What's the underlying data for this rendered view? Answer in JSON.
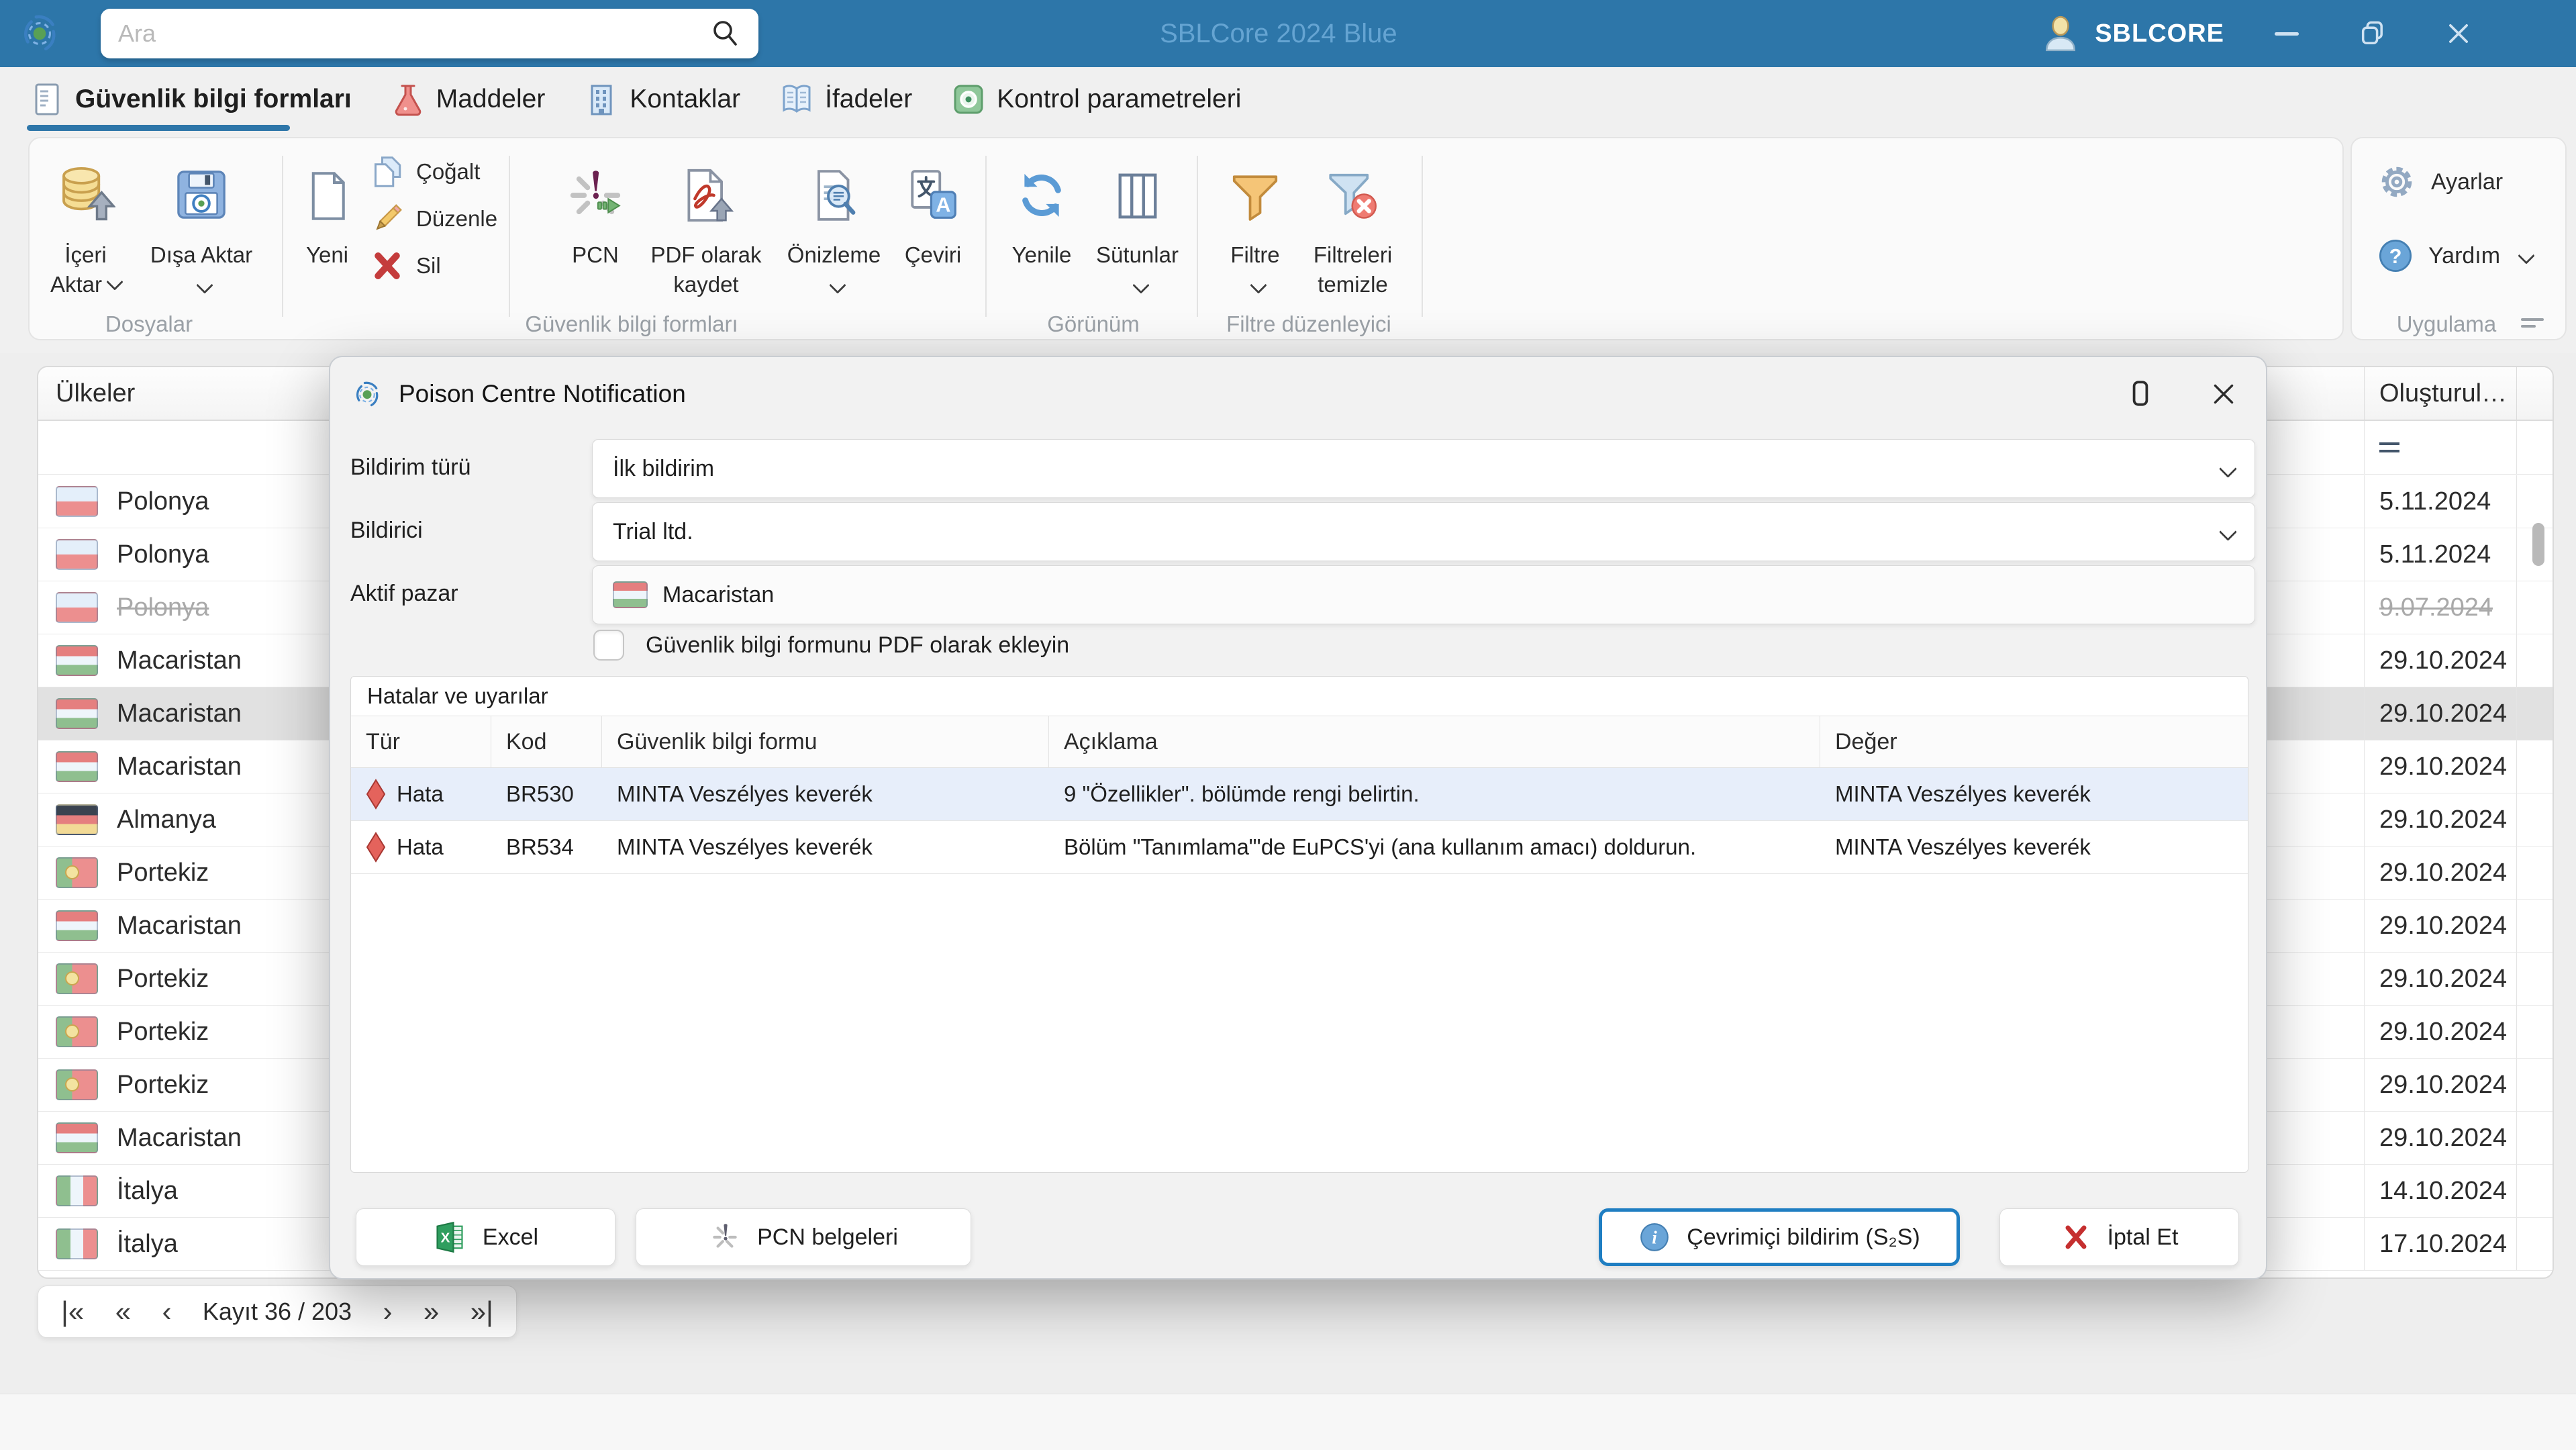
{
  "colors": {
    "titlebar_bg": "#2d76a9",
    "accent": "#2e76a9",
    "primary_button_border": "#1f7ec2",
    "error_red": "#e4635c",
    "selected_row": "#e1e1e1",
    "error_row_selected": "#e7eefa"
  },
  "titlebar": {
    "search_placeholder": "Ara",
    "app_title": "SBLCore 2024 Blue",
    "account_label": "SBLCORE"
  },
  "tabs": [
    {
      "label": "Güvenlik bilgi formları",
      "active": true
    },
    {
      "label": "Maddeler",
      "active": false
    },
    {
      "label": "Kontaklar",
      "active": false
    },
    {
      "label": "İfadeler",
      "active": false
    },
    {
      "label": "Kontrol parametreleri",
      "active": false
    }
  ],
  "ribbon": {
    "groups": {
      "dosyalar": "Dosyalar",
      "guvenlik": "Güvenlik bilgi formları",
      "gorunum": "Görünüm",
      "filtre_duzenleyici": "Filtre düzenleyici",
      "uygulama": "Uygulama"
    },
    "buttons": {
      "iceri_l1": "İçeri",
      "iceri_l2": "Aktar",
      "disa": "Dışa Aktar",
      "yeni": "Yeni",
      "cogalt": "Çoğalt",
      "duzenle": "Düzenle",
      "sil": "Sil",
      "pcn": "PCN",
      "pdf_l1": "PDF olarak",
      "pdf_l2": "kaydet",
      "onizleme": "Önizleme",
      "ceviri": "Çeviri",
      "yenile": "Yenile",
      "sutunlar": "Sütunlar",
      "filtre": "Filtre",
      "filtreleri_l1": "Filtreleri",
      "filtreleri_l2": "temizle",
      "ayarlar": "Ayarlar",
      "yardim": "Yardım"
    }
  },
  "table": {
    "header_country": "Ülkeler",
    "header_created": "Oluşturul…",
    "rows": [
      {
        "country": "Polonya",
        "flag": "pl",
        "date": "5.11.2024"
      },
      {
        "country": "Polonya",
        "flag": "pl",
        "date": "5.11.2024"
      },
      {
        "country": "Polonya",
        "flag": "pl",
        "date": "9.07.2024",
        "struck": true
      },
      {
        "country": "Macaristan",
        "flag": "hu",
        "date": "29.10.2024"
      },
      {
        "country": "Macaristan",
        "flag": "hu",
        "date": "29.10.2024",
        "selected": true
      },
      {
        "country": "Macaristan",
        "flag": "hu",
        "date": "29.10.2024"
      },
      {
        "country": "Almanya",
        "flag": "de",
        "date": "29.10.2024"
      },
      {
        "country": "Portekiz",
        "flag": "pt",
        "date": "29.10.2024"
      },
      {
        "country": "Macaristan",
        "flag": "hu",
        "date": "29.10.2024"
      },
      {
        "country": "Portekiz",
        "flag": "pt",
        "date": "29.10.2024"
      },
      {
        "country": "Portekiz",
        "flag": "pt",
        "date": "29.10.2024"
      },
      {
        "country": "Portekiz",
        "flag": "pt",
        "date": "29.10.2024"
      },
      {
        "country": "Macaristan",
        "flag": "hu",
        "date": "29.10.2024"
      },
      {
        "country": "İtalya",
        "flag": "it",
        "date": "14.10.2024"
      },
      {
        "country": "İtalya",
        "flag": "it",
        "date": "17.10.2024"
      }
    ]
  },
  "pagination": {
    "record_label": "Kayıt 36 / 203",
    "icons": {
      "first": "|«",
      "prev_fast": "«",
      "prev": "‹",
      "next": "›",
      "next_fast": "»",
      "last": "»|"
    }
  },
  "dialog": {
    "title": "Poison Centre Notification",
    "fields": {
      "bildirim_turu_label": "Bildirim türü",
      "bildirim_turu_value": "İlk bildirim",
      "bildirici_label": "Bildirici",
      "bildirici_value": "Trial ltd.",
      "aktif_pazar_label": "Aktif pazar",
      "aktif_pazar_value": "Macaristan"
    },
    "checkbox": {
      "label": "Güvenlik bilgi formunu PDF olarak ekleyin",
      "checked": false
    },
    "errors": {
      "group_title": "Hatalar ve uyarılar",
      "columns": [
        "Tür",
        "Kod",
        "Güvenlik bilgi formu",
        "Açıklama",
        "Değer"
      ],
      "rows": [
        {
          "type": "Hata",
          "code": "BR530",
          "form": "MINTA Veszélyes keverék",
          "description": "9 \"Özellikler\". bölümde rengi belirtin.",
          "value": "MINTA Veszélyes keverék",
          "selected": true
        },
        {
          "type": "Hata",
          "code": "BR534",
          "form": "MINTA Veszélyes keverék",
          "description": "Bölüm \"Tanımlama\"'de EuPCS'yi (ana kullanım amacı) doldurun.",
          "value": "MINTA Veszélyes keverék",
          "selected": false
        }
      ]
    },
    "buttons": {
      "excel": "Excel",
      "pcn_docs": "PCN belgeleri",
      "online": "Çevrimiçi bildirim (S₂S)",
      "cancel": "İptal Et"
    }
  }
}
